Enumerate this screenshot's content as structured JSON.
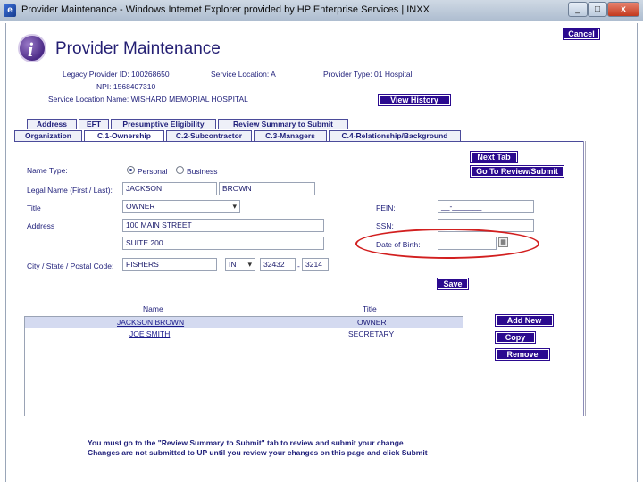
{
  "window": {
    "title": "Provider Maintenance - Windows Internet Explorer provided by HP Enterprise Services | INXX",
    "minimize": "_",
    "maximize": "□",
    "close": "x"
  },
  "header": {
    "logo_letter": "i",
    "page_title": "Provider Maintenance",
    "cancel_label": "Cancel",
    "view_history_label": "View History"
  },
  "provider_info": {
    "legacy_id": "Legacy Provider ID: 100268650",
    "service_location": "Service Location: A",
    "provider_type": "Provider Type: 01 Hospital",
    "npi": "NPI: 1568407310",
    "service_location_name": "Service Location Name: WISHARD MEMORIAL HOSPITAL"
  },
  "tabs_top": [
    "Address",
    "EFT",
    "Presumptive Eligibility",
    "Review Summary to Submit"
  ],
  "tabs_bottom": [
    "Organization",
    "C.1-Ownership",
    "C.2-Subcontractor",
    "C.3-Managers",
    "C.4-Relationship/Background"
  ],
  "active_tab": "C.1-Ownership",
  "actions": {
    "next_tab": "Next Tab",
    "go_review": "Go To Review/Submit",
    "save": "Save",
    "add_new": "Add New",
    "copy": "Copy",
    "remove": "Remove"
  },
  "form": {
    "name_type_label": "Name Type:",
    "radio_personal": "Personal",
    "radio_business": "Business",
    "legal_name_label": "Legal Name (First / Last):",
    "first_name": "JACKSON",
    "last_name": "BROWN",
    "title_label": "Title",
    "title_value": "OWNER",
    "address_label": "Address",
    "address1": "100 MAIN STREET",
    "address2": "SUITE 200",
    "city_label": "City / State / Postal Code:",
    "city": "FISHERS",
    "state": "IN",
    "zip": "32432",
    "zip4": "3214",
    "fein_label": "FEIN:",
    "fein_value": "__-_______",
    "ssn_label": "SSN:",
    "ssn_value": "",
    "dob_label": "Date of Birth:",
    "dob_value": ""
  },
  "table": {
    "headers": [
      "Name",
      "Title"
    ],
    "rows": [
      {
        "name": "JACKSON BROWN",
        "title": "OWNER"
      },
      {
        "name": "JOE SMITH",
        "title": "SECRETARY"
      }
    ]
  },
  "footer": {
    "line1": "You must go to the \"Review Summary to Submit\" tab to review and submit your change",
    "line2": "Changes are not submitted to UP until you review your changes on this page and click Submit"
  },
  "colors": {
    "button_bg": "#2b0a8f",
    "text": "#1f1f7a",
    "highlight_ellipse": "#d21f1f"
  }
}
